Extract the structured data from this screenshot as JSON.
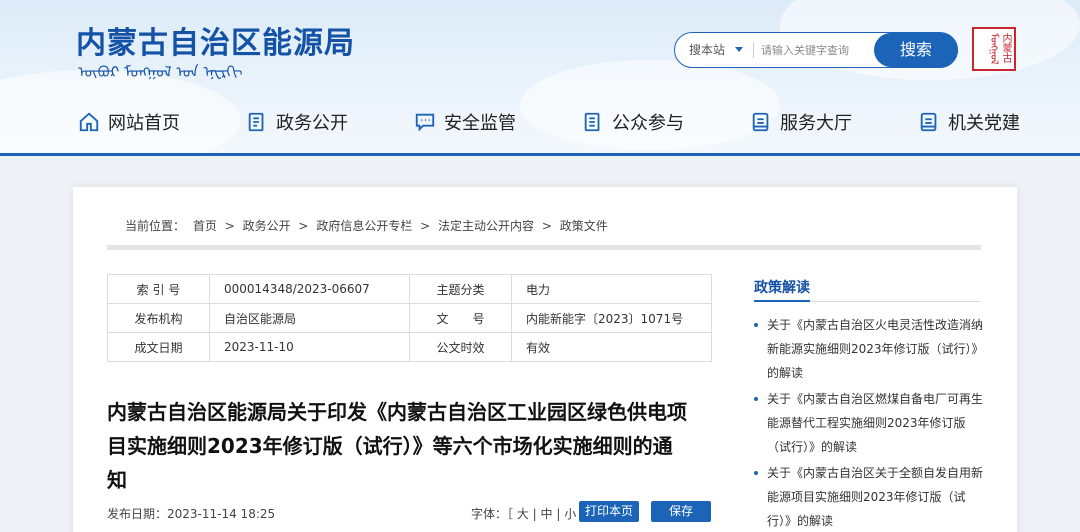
{
  "header": {
    "site_title": "内蒙古自治区能源局",
    "mongolian_script": "ᠥᠪᠦᠷ ᠮᠣᠩᠭᠣᠯ ᠤᠨ ᠡᠨᠧᠷᠭᠢ",
    "seal_text": "内蒙古 ᠮᠣᠩᠭᠣᠯ",
    "search": {
      "scope_label": "搜本站",
      "placeholder": "请输入关键字查询",
      "button_label": "搜索"
    },
    "nav": [
      {
        "label": "网站首页",
        "icon": "home-icon"
      },
      {
        "label": "政务公开",
        "icon": "document-icon"
      },
      {
        "label": "安全监管",
        "icon": "chat-icon"
      },
      {
        "label": "公众参与",
        "icon": "list-icon"
      },
      {
        "label": "服务大厅",
        "icon": "book-icon"
      },
      {
        "label": "机关党建",
        "icon": "book-icon"
      }
    ],
    "accent_color": "#1b64b8"
  },
  "breadcrumb": {
    "prefix": "当前位置：",
    "items": [
      "首页",
      "政务公开",
      "政府信息公开专栏",
      "法定主动公开内容",
      "政策文件"
    ],
    "separator": ">"
  },
  "meta_table": {
    "rows": [
      {
        "l1": "索 引 号",
        "v1": "000014348/2023-06607",
        "l2": "主题分类",
        "v2": "电力"
      },
      {
        "l1": "发布机构",
        "v1": "自治区能源局",
        "l2": "文　　号",
        "v2": "内能新能字〔2023〕1071号"
      },
      {
        "l1": "成文日期",
        "v1": "2023-11-10",
        "l2": "公文时效",
        "v2": "有效"
      }
    ]
  },
  "document": {
    "title": "内蒙古自治区能源局关于印发《内蒙古自治区工业园区绿色供电项目实施细则2023年修订版（试行）》等六个市场化实施细则的通知",
    "pub_date": "发布日期：2023-11-14 18:25",
    "font_label": "字体：［",
    "font_sizes": [
      "大",
      "中",
      "小"
    ],
    "font_close": "］",
    "print_label": "打印本页",
    "save_label": "保存"
  },
  "sidebar": {
    "title": "政策解读",
    "items": [
      "关于《内蒙古自治区火电灵活性改造消纳新能源实施细则2023年修订版（试行）》的解读",
      "关于《内蒙古自治区燃煤自备电厂可再生能源替代工程实施细则2023年修订版（试行）》的解读",
      "关于《内蒙古自治区关于全额自发自用新能源项目实施细则2023年修订版（试行）》的解读"
    ]
  }
}
